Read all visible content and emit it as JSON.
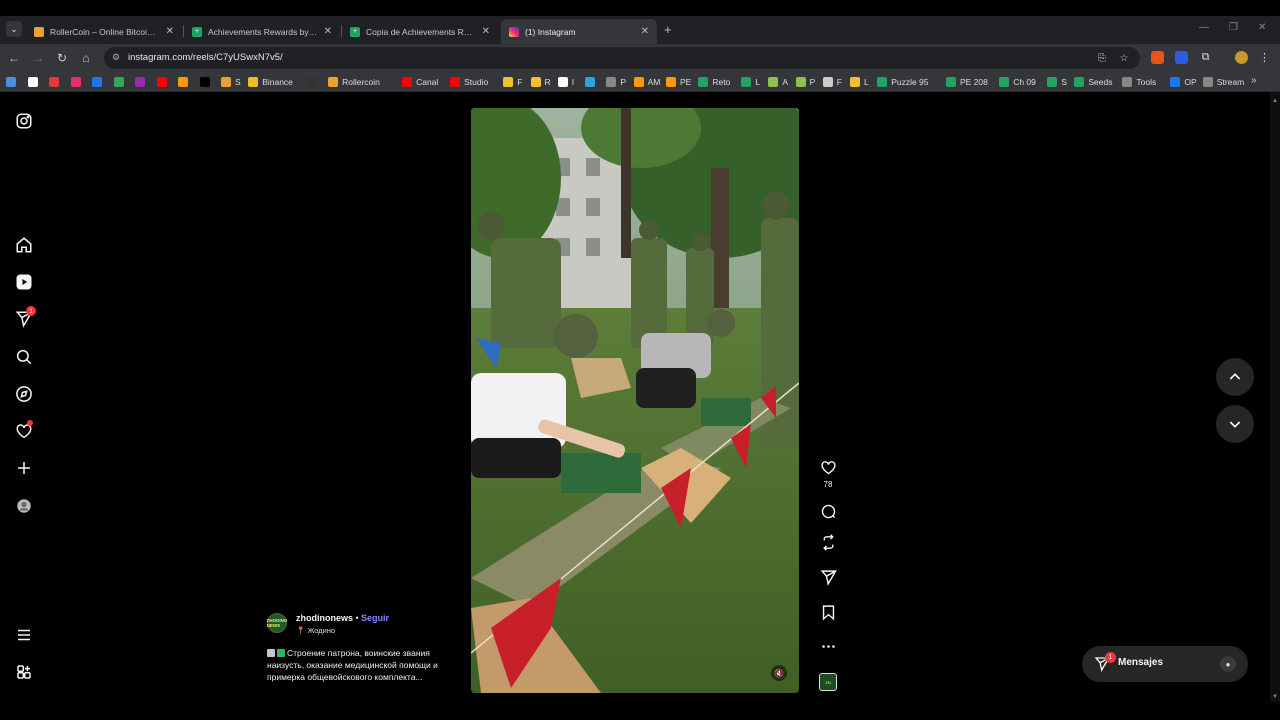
{
  "browser": {
    "tabs": [
      {
        "title": "RollerCoin – Online Bitcoin Min",
        "icon": "rollercoin-icon",
        "color": "#f0a030"
      },
      {
        "title": "Achievements Rewards by Pierc",
        "icon": "sheets-icon",
        "color": "#1fa463"
      },
      {
        "title": "Copia de Achievements Reward",
        "icon": "sheets-icon",
        "color": "#1fa463"
      },
      {
        "title": "(1) Instagram",
        "icon": "instagram-icon",
        "color": "#e1306c"
      }
    ],
    "new_tab": "+",
    "url": "instagram.com/reels/C7yUSwxN7v5/",
    "bookmarks": [
      {
        "label": "",
        "color": "#4a90e2"
      },
      {
        "label": "",
        "color": "#ffffff"
      },
      {
        "label": "",
        "color": "#e53935"
      },
      {
        "label": "",
        "color": "#e1306c"
      },
      {
        "label": "",
        "color": "#1877f2"
      },
      {
        "label": "",
        "color": "#34a853"
      },
      {
        "label": "",
        "color": "#9c27b0"
      },
      {
        "label": "",
        "color": "#ff0000"
      },
      {
        "label": "",
        "color": "#ff9800"
      },
      {
        "label": "",
        "color": "#000000"
      },
      {
        "label": "S",
        "color": "#f0a030"
      },
      {
        "label": "Binance",
        "color": "#f3ba2f"
      },
      {
        "label": "",
        "color": "#333333"
      },
      {
        "label": "Rollercoin",
        "color": "#f0a030"
      },
      {
        "label": "Canal",
        "color": "#ff0000"
      },
      {
        "label": "Studio",
        "color": "#ff0000"
      },
      {
        "label": "F",
        "color": "#f3c030"
      },
      {
        "label": "R",
        "color": "#f3c030"
      },
      {
        "label": "I",
        "color": "#ffffff"
      },
      {
        "label": "",
        "color": "#2aa3e0"
      },
      {
        "label": "P",
        "color": "#888888"
      },
      {
        "label": "AM",
        "color": "#ff9900"
      },
      {
        "label": "PE",
        "color": "#ff9900"
      },
      {
        "label": "Reto",
        "color": "#1fa463"
      },
      {
        "label": "L",
        "color": "#1fa463"
      },
      {
        "label": "A",
        "color": "#8bc34a"
      },
      {
        "label": "P",
        "color": "#8bc34a"
      },
      {
        "label": "F",
        "color": "#cccccc"
      },
      {
        "label": "L",
        "color": "#f3c030"
      },
      {
        "label": "Puzzle 95",
        "color": "#1fa463"
      },
      {
        "label": "PE 208",
        "color": "#1fa463"
      },
      {
        "label": "Ch 09",
        "color": "#1fa463"
      },
      {
        "label": "S",
        "color": "#1fa463"
      },
      {
        "label": "Seeds",
        "color": "#1fa463"
      },
      {
        "label": "Tools",
        "color": "#888888"
      },
      {
        "label": "OP",
        "color": "#1877f2"
      },
      {
        "label": "Stream",
        "color": "#888888"
      }
    ],
    "bookmarks_more": "»"
  },
  "sidebar": {
    "items": [
      {
        "name": "instagram-logo-icon"
      },
      {
        "name": "home-icon"
      },
      {
        "name": "reels-icon"
      },
      {
        "name": "direct-icon",
        "badge": "1"
      },
      {
        "name": "search-icon"
      },
      {
        "name": "explore-icon"
      },
      {
        "name": "notifications-heart-icon"
      },
      {
        "name": "create-icon"
      },
      {
        "name": "profile-avatar-icon"
      },
      {
        "name": "more-menu-icon"
      },
      {
        "name": "also-from-meta-icon"
      }
    ]
  },
  "reel": {
    "likes": "78",
    "username": "zhodinonews",
    "separator": "•",
    "follow": "Seguir",
    "location": "Жодино",
    "avatar_text": "ZHODINO NEWS",
    "caption": "Строение патрона, воинские звания наизусть, оказание медицинской помощи и примерка общевойскового комплекта..."
  },
  "messages": {
    "label": "Mensajes",
    "badge": "1"
  },
  "colors": {
    "accent_link": "#7b8cff",
    "badge_red": "#ff3040",
    "page_bg": "#000000"
  }
}
